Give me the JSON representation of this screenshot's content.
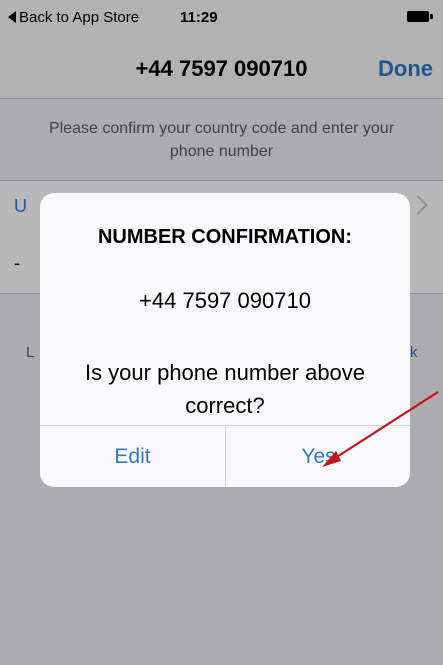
{
  "status_bar": {
    "back_label": "Back to App Store",
    "time": "11:29"
  },
  "nav": {
    "title": "+44 7597 090710",
    "done_label": "Done"
  },
  "instructions": "Please confirm your country code and enter your phone number",
  "background_form": {
    "country_initial": "U",
    "phone_prefix": "-",
    "left_text": "L",
    "right_link": "k"
  },
  "alert": {
    "title": "NUMBER CONFIRMATION:",
    "number": "+44 7597 090710",
    "message": "Is your phone number above correct?",
    "edit_label": "Edit",
    "yes_label": "Yes"
  },
  "colors": {
    "accent": "#2f78c4",
    "annotation_arrow": "#c0151b"
  }
}
